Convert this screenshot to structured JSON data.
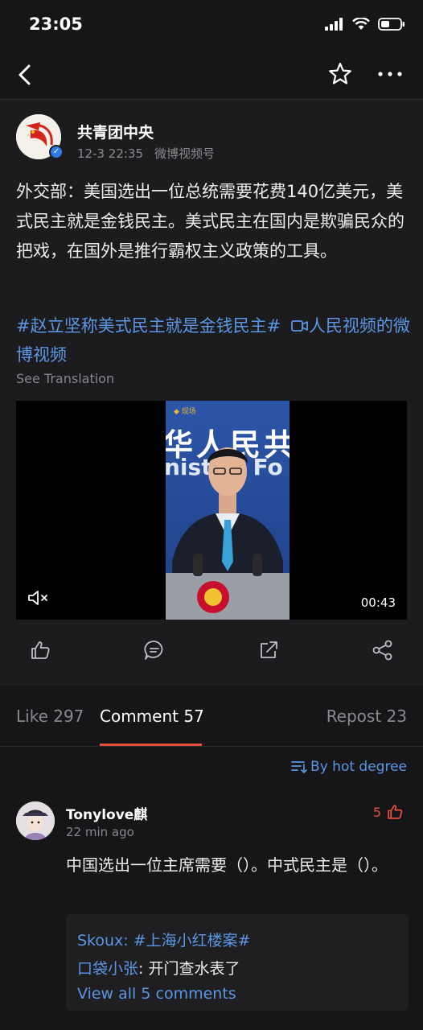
{
  "status": {
    "time": "23:05"
  },
  "post": {
    "author": "共青团中央",
    "date": "12-3 22:35",
    "source": "微博视频号",
    "text": "外交部：美国选出一位总统需要花费140亿美元，美式民主就是金钱民主。美式民主在国内是欺骗民众的把戏，在国外是推行霸权主义政策的工具。",
    "hashtag": "#赵立坚称美式民主就是金钱民主#",
    "video_link": "人民视频的微博视频",
    "see_translation": "See Translation",
    "video": {
      "backdrop_text": "华人民共",
      "backdrop_text2": "nist  of Fo",
      "duration": "00:43"
    }
  },
  "tabs": [
    {
      "label": "Like 297",
      "active": false
    },
    {
      "label": "Comment 57",
      "active": true
    },
    {
      "label": "Repost 23",
      "active": false
    }
  ],
  "sort_label": "By hot degree",
  "comment": {
    "user": "Tonylove麒",
    "time": "22 min ago",
    "likes": "5",
    "text": "中国选出一位主席需要（）。中式民主是（）。",
    "replies": [
      {
        "name": "Skoux",
        "text": "#上海小红楼案#"
      },
      {
        "name": "口袋小张",
        "text": "开门查水表了"
      }
    ],
    "view_all": "View all 5 comments"
  },
  "colors": {
    "accent": "#e8503e",
    "link": "#5a96e4",
    "bg": "#161618",
    "card": "#1c1c1e"
  }
}
